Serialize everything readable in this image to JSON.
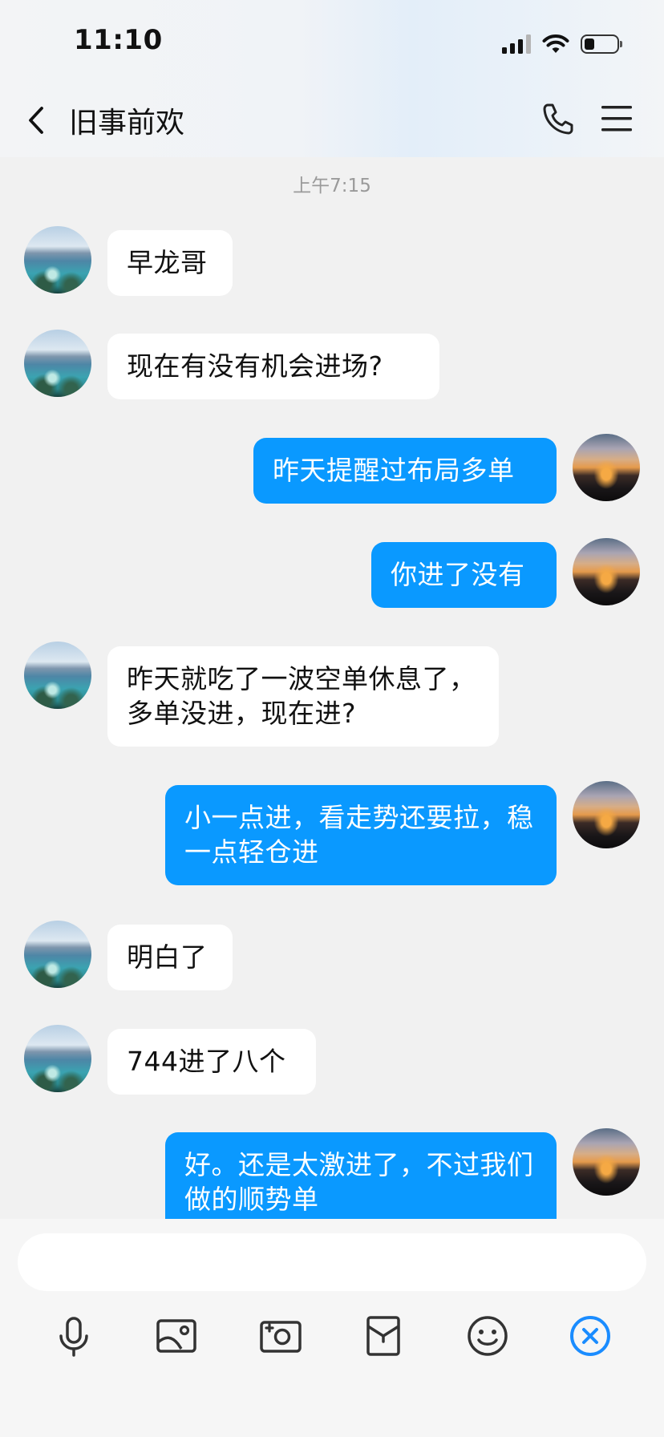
{
  "status_bar": {
    "time": "11:10"
  },
  "header": {
    "title": "旧事前欢"
  },
  "chat": {
    "timestamp": "上午7:15",
    "messages": [
      {
        "side": "left",
        "text": "早龙哥"
      },
      {
        "side": "left",
        "text": "现在有没有机会进场?"
      },
      {
        "side": "right",
        "text": "昨天提醒过布局多单"
      },
      {
        "side": "right",
        "text": "你进了没有"
      },
      {
        "side": "left",
        "text": "昨天就吃了一波空单休息了，多单没进，现在进?"
      },
      {
        "side": "right",
        "text": "小一点进，看走势还要拉，稳一点轻仓进"
      },
      {
        "side": "left",
        "text": "明白了"
      },
      {
        "side": "left",
        "text": "744进了八个"
      },
      {
        "side": "right",
        "text": "好。还是太激进了，不过我们做的顺势单"
      }
    ]
  },
  "composer": {
    "input_value": "",
    "tools": [
      "mic-icon",
      "image-icon",
      "camera-icon",
      "red-packet-icon",
      "emoji-icon",
      "close-icon"
    ]
  },
  "colors": {
    "accent": "#0a99ff",
    "incoming_bubble": "#ffffff",
    "background": "#f1f1f1"
  }
}
